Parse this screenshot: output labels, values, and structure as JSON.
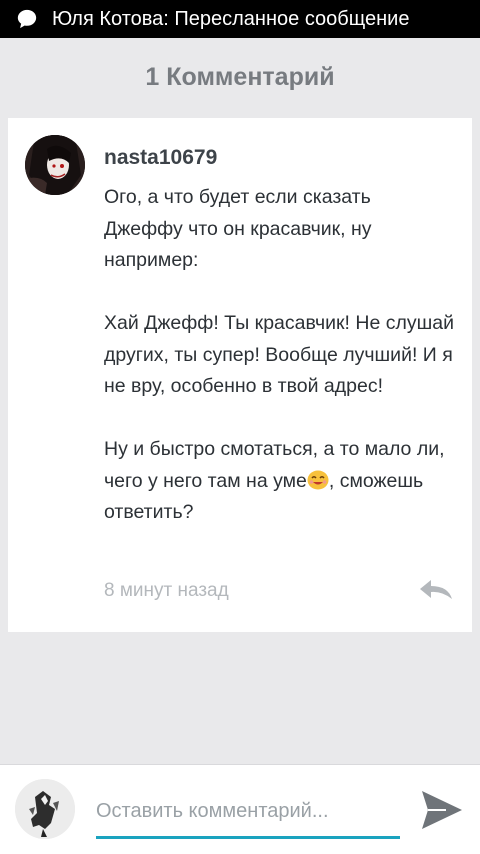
{
  "statusbar": {
    "title": "Юля Котова: Пересланное сообщение",
    "icon": "chat-bubble-icon"
  },
  "comments": {
    "count_label": "1 Комментарий",
    "items": [
      {
        "username": "nasta10679",
        "text": "Ого, а что будет если сказать Джеффу что он красавчик, ну например:\n\nХай Джефф! Ты красавчик! Не слушай других, ты супер! Вообще лучший! И я не вру, особенно в твой адрес!\n\nНу и быстро смотаться, а то мало ли, чего у него там на уме",
        "text_after_emoji": ", сможешь ответить?",
        "emoji": "smiling-face-emoji",
        "timestamp": "8 минут назад",
        "reply_icon": "reply-icon"
      }
    ]
  },
  "composer": {
    "placeholder": "Оставить комментарий...",
    "send_icon": "send-icon"
  },
  "colors": {
    "accent": "#1aa3bf",
    "background": "#e9e9eb",
    "header_text": "#777b80",
    "timestamp": "#b4b8bc"
  }
}
